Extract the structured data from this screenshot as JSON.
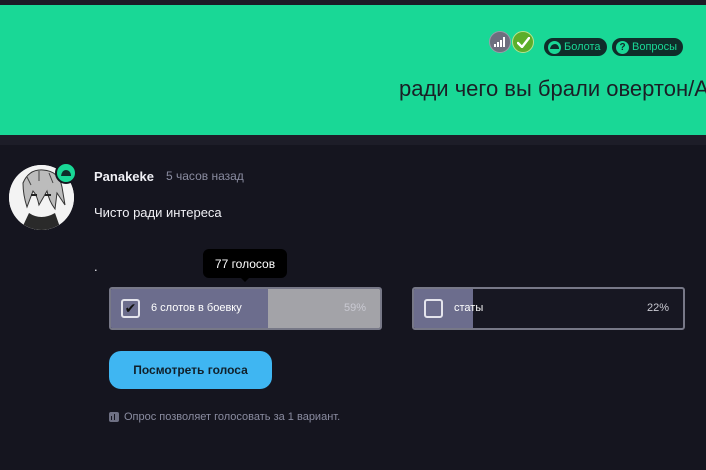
{
  "header": {
    "title": "ради чего вы брали овертон/А",
    "tags": [
      {
        "label": "Болота",
        "icon": "turtle-icon"
      },
      {
        "label": "Вопросы",
        "icon": "question-icon"
      }
    ],
    "status_icons": [
      "signal-bars-icon",
      "check-icon"
    ]
  },
  "post": {
    "author": "Panakeke",
    "time": "5 часов назад",
    "text": "Чисто ради интереса",
    "dot": "."
  },
  "poll": {
    "tooltip": "77 голосов",
    "options": [
      {
        "label": "6 слотов в боевку",
        "percent": "59%",
        "checked": true,
        "fill_fraction": 0.59
      },
      {
        "label": "статы",
        "percent": "22%",
        "checked": false,
        "fill_fraction": 0.22
      }
    ],
    "view_votes_label": "Посмотреть голоса",
    "note": "Опрос позволяет голосовать за 1 вариант."
  },
  "colors": {
    "banner": "#19d896",
    "background": "#15151f",
    "button": "#3fb6f2"
  }
}
